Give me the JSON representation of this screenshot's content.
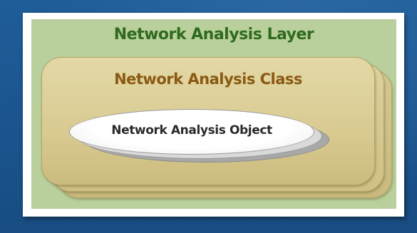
{
  "diagram": {
    "layer": {
      "label": "Network Analysis Layer",
      "color": "#2f6b1e"
    },
    "class": {
      "label": "Network Analysis Class",
      "color": "#8a5a12"
    },
    "object": {
      "label": "Network Analysis Object",
      "color": "#2a2a2a"
    }
  }
}
